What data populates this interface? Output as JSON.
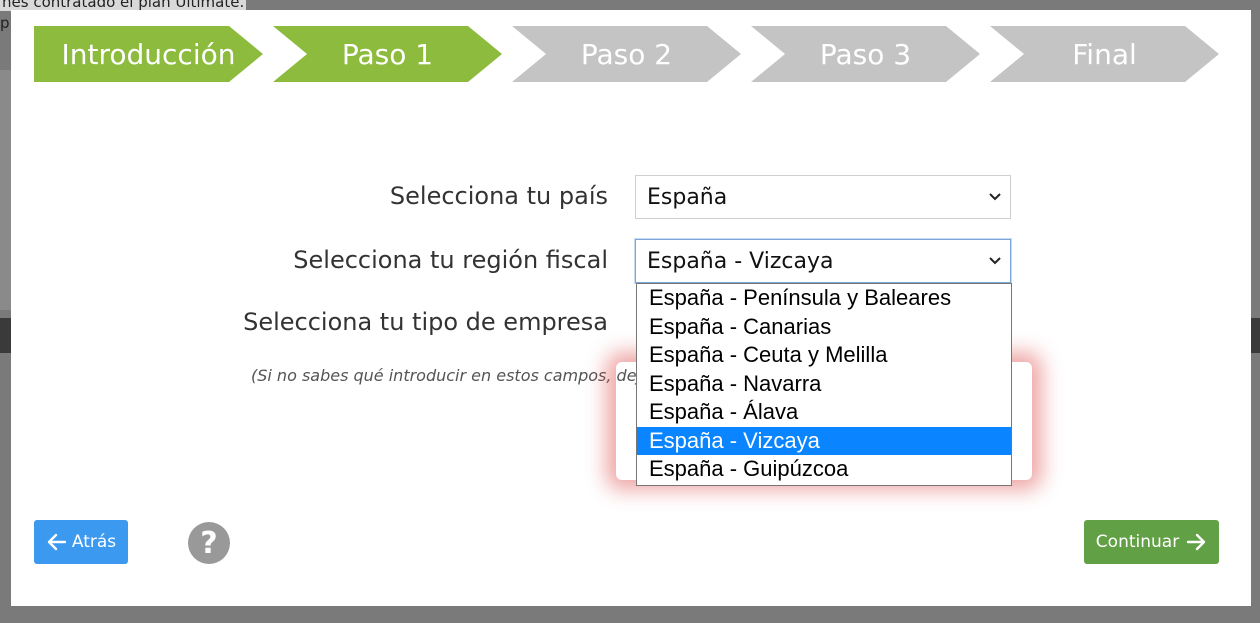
{
  "background": {
    "top_text": "nes contratado el plan Ultimate.",
    "top_text_2": "p"
  },
  "steps": [
    {
      "label": "Introducción",
      "state": "active"
    },
    {
      "label": "Paso 1",
      "state": "active"
    },
    {
      "label": "Paso 2",
      "state": "inactive"
    },
    {
      "label": "Paso 3",
      "state": "inactive"
    },
    {
      "label": "Final",
      "state": "inactive"
    }
  ],
  "form": {
    "country_label": "Selecciona tu país",
    "country_value": "España",
    "region_label": "Selecciona tu región fiscal",
    "region_value": "España - Vizcaya",
    "company_label": "Selecciona tu tipo de empresa",
    "hint": "(Si no sabes qué introducir en estos campos, deja l"
  },
  "region_options": [
    "España - Península y Baleares",
    "España - Canarias",
    "España - Ceuta y Melilla",
    "España - Navarra",
    "España - Álava",
    "España - Vizcaya",
    "España - Guipúzcoa"
  ],
  "region_selected_index": 5,
  "buttons": {
    "back": "Atrás",
    "help": "?",
    "continue": "Continuar"
  },
  "colors": {
    "step_active": "#8dbb3e",
    "step_inactive": "#c4c4c4",
    "back_button": "#3b99f0",
    "continue_button": "#62a045",
    "option_selected": "#0a84ff"
  }
}
